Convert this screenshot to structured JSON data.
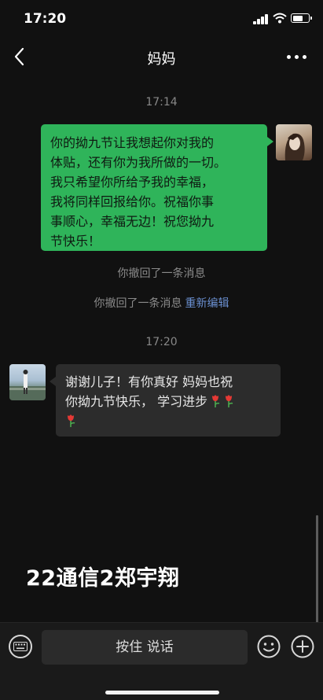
{
  "status_bar": {
    "time": "17:20"
  },
  "header": {
    "title": "妈妈"
  },
  "messages": {
    "time_1": "17:14",
    "sent_text": "你的拗九节让我想起你对我的\n体贴，还有你为我所做的一切。\n我只希望你所给予我的幸福，\n我将同样回报给你。祝福你事\n事顺心，幸福无边！祝您拗九\n节快乐！",
    "recall_1": "你撤回了一条消息",
    "recall_2": "你撤回了一条消息",
    "reedit": "重新编辑",
    "time_2": "17:20",
    "received_text_1": "谢谢儿子！有你真好 妈妈也祝",
    "received_text_2": "你拗九节快乐， 学习进步"
  },
  "watermark": "22通信2郑宇翔",
  "input_bar": {
    "hold_to_talk": "按住 说话"
  },
  "colors": {
    "sent_bubble": "#2fb45a",
    "received_bubble": "#2c2c2c",
    "background": "#111111",
    "link": "#6a8fd0"
  },
  "icons": [
    "signal-icon",
    "wifi-icon",
    "battery-icon",
    "back-icon",
    "more-icon",
    "flower-icon",
    "keyboard-icon",
    "emoji-icon",
    "plus-icon"
  ]
}
